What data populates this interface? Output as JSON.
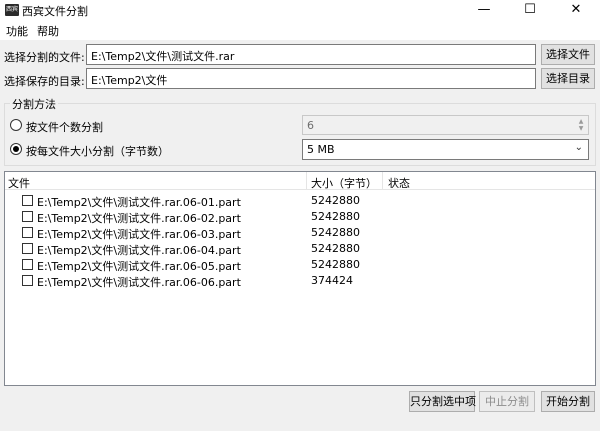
{
  "window": {
    "title": "西宾文件分割",
    "icon_text": "西宾",
    "minimize_glyph": "—",
    "maximize_glyph": "☐",
    "close_glyph": "✕"
  },
  "menu": [
    "功能",
    "帮助"
  ],
  "source": {
    "label": "选择分割的文件:",
    "value": "E:\\Temp2\\文件\\测试文件.rar",
    "button": "选择文件"
  },
  "target": {
    "label": "选择保存的目录:",
    "value": "E:\\Temp2\\文件",
    "button": "选择目录"
  },
  "split_method": {
    "title": "分割方法",
    "by_count": {
      "label": "按文件个数分割",
      "selected": false,
      "value": "6"
    },
    "by_size": {
      "label": "按每文件大小分割（字节数）",
      "selected": true,
      "value": "5 MB"
    }
  },
  "file_list": {
    "columns": [
      "文件",
      "大小（字节）",
      "状态"
    ],
    "rows": [
      {
        "name": "E:\\Temp2\\文件\\测试文件.rar.06-01.part",
        "size": "5242880",
        "status": "",
        "checked": false
      },
      {
        "name": "E:\\Temp2\\文件\\测试文件.rar.06-02.part",
        "size": "5242880",
        "status": "",
        "checked": false
      },
      {
        "name": "E:\\Temp2\\文件\\测试文件.rar.06-03.part",
        "size": "5242880",
        "status": "",
        "checked": false
      },
      {
        "name": "E:\\Temp2\\文件\\测试文件.rar.06-04.part",
        "size": "5242880",
        "status": "",
        "checked": false
      },
      {
        "name": "E:\\Temp2\\文件\\测试文件.rar.06-05.part",
        "size": "5242880",
        "status": "",
        "checked": false
      },
      {
        "name": "E:\\Temp2\\文件\\测试文件.rar.06-06.part",
        "size": "374424",
        "status": "",
        "checked": false
      }
    ]
  },
  "actions": {
    "split_selected": "只分割选中项",
    "stop": "中止分割",
    "start": "开始分割"
  }
}
